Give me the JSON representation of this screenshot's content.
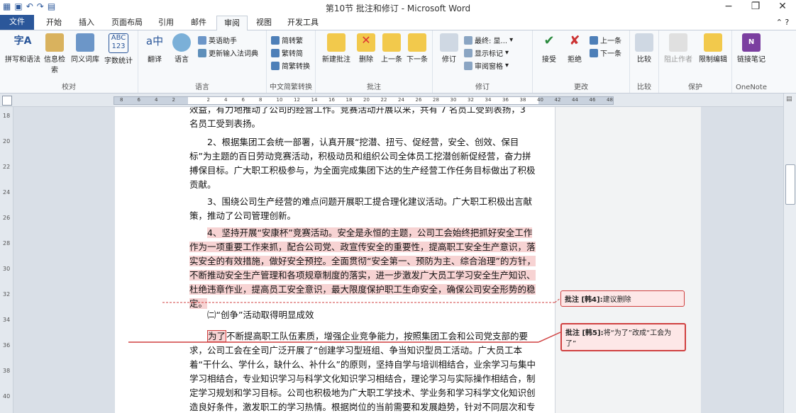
{
  "window": {
    "title": "第10节 批注和修订 - Microsoft Word"
  },
  "tabs": [
    "文件",
    "开始",
    "插入",
    "页面布局",
    "引用",
    "邮件",
    "审阅",
    "视图",
    "开发工具"
  ],
  "active_tab": "审阅",
  "ribbon": {
    "proofing": {
      "label": "校对",
      "spelling": "拼写和语法",
      "research": "信息检索",
      "thesaurus": "同义词库",
      "wordcount": "字数统计"
    },
    "language": {
      "label": "语言",
      "translate": "翻译",
      "language": "语言",
      "english_assistant": "英语助手",
      "update_ime": "更新输入法词典"
    },
    "chinese": {
      "label": "中文简繁转换",
      "to_trad": "简转繁",
      "to_simp": "繁转简",
      "convert": "简繁转换"
    },
    "comments": {
      "label": "批注",
      "new": "新建批注",
      "delete": "删除",
      "prev": "上一条",
      "next": "下一条"
    },
    "tracking": {
      "label": "修订",
      "track": "修订",
      "final": "最终: 显...",
      "show_markup": "显示标记",
      "review_pane": "审阅窗格"
    },
    "changes": {
      "label": "更改",
      "accept": "接受",
      "reject": "拒绝",
      "prev": "上一条",
      "next": "下一条"
    },
    "compare": {
      "label": "比较",
      "compare": "比较"
    },
    "protect": {
      "label": "保护",
      "block_authors": "阻止作者",
      "restrict": "限制编辑"
    },
    "onenote": {
      "label": "OneNote",
      "linked": "链接笔记"
    }
  },
  "document": {
    "p0_tail": "效益，有力地推动了公司的经营工作。竞赛活动开展以来，共有 7 名员工受到表扬，3 名员工受到表扬。",
    "p2": "2、根据集团工会统一部署，认真开展“挖潜、扭亏、促经营，安全、创效、保目标”为主题的百日劳动竞赛活动，积极动员和组织公司全体员工挖潜创新促经营，奋力拼搏保目标。广大职工积极参与，为全面完成集团下达的生产经营工作任务目标做出了积极贡献。",
    "p3": "3、围绕公司生产经营的难点问题开展职工提合理化建议活动。广大职工积极出言献策，推动了公司管理创新。",
    "p4": "4、坚持开展“安康杯”竞赛活动。安全是永恒的主题，公司工会始终把抓好安全工作作为一项重要工作来抓，配合公司党、政宣传安全的重要性，提高职工安全生产意识，落实安全的有效措施，做好安全预控。全面贯彻“安全第一、预防为主、综合治理”的方针，不断推动安全生产管理和各项规章制度的落实，进一步激发广大员工学习安全生产知识、杜绝违章作业，提高员工安全意识，最大限度保护职工生命安全，确保公司安全形势的稳定。",
    "heading2": "㈡“创争”活动取得明显成效",
    "p5_word": "为了",
    "p5": "不断提高职工队伍素质，增强企业竞争能力，按照集团工会和公司党支部的要求，公司工会在全司广泛开展了“创建学习型班组、争当知识型员工活动。广大员工本着“干什么、学什么，缺什么、补什么”的原则，坚持自学与培训相结合，业余学习与集中学习相结合，专业知识学习与科学文化知识学习相结合，理论学习与实际操作相结合，制定学习规划和学习目标。公司也积极地为广大职工学技术、学业务和学习科学文化知识创造良好条件，激发职工的学习热情。根据岗位的当前需要和发展趋势，针对不同层次和专业特点及发展要求，制定员工培训计划，通过内部培训与外部培训相结合的"
  },
  "comments": [
    {
      "tag": "批注 [韩4]:",
      "text": "建议删除"
    },
    {
      "tag": "批注 [韩5]:",
      "text": "将“为了”改成“工会为了”"
    }
  ],
  "ruler_numbers": [
    "8",
    "6",
    "4",
    "2",
    "",
    "2",
    "4",
    "6",
    "8",
    "10",
    "12",
    "14",
    "16",
    "18",
    "20",
    "22",
    "24",
    "26",
    "28",
    "30",
    "32",
    "34",
    "36",
    "38",
    "40",
    "42",
    "44",
    "46",
    "48"
  ],
  "vruler_numbers": [
    "18",
    "20",
    "22",
    "24",
    "26",
    "28",
    "30",
    "32",
    "34",
    "36",
    "38",
    "40"
  ]
}
